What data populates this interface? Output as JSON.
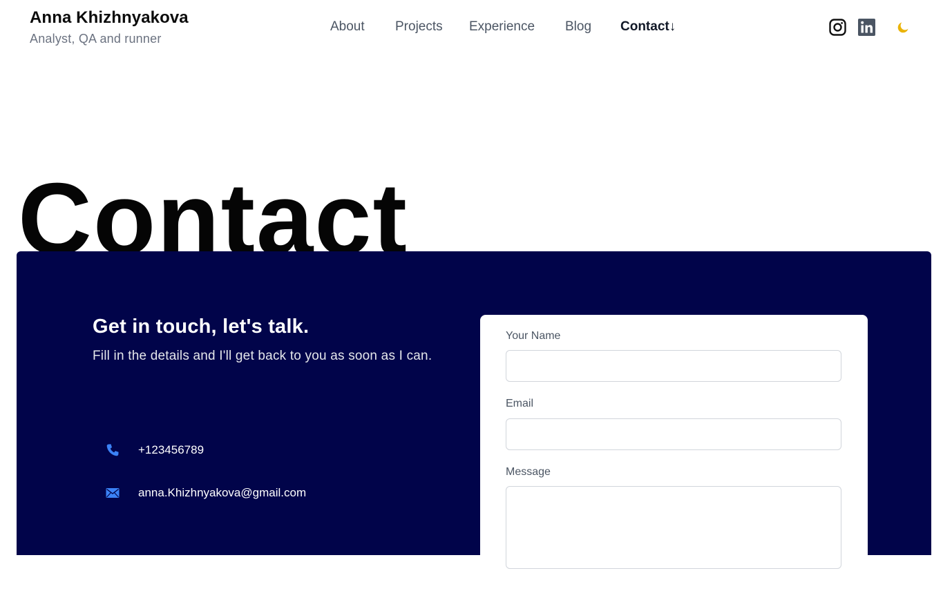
{
  "header": {
    "name": "Anna Khizhnyakova",
    "tagline": "Analyst, QA and runner",
    "nav": [
      {
        "label": "About",
        "active": false
      },
      {
        "label": "Projects",
        "active": false
      },
      {
        "label": "Experience",
        "active": false
      },
      {
        "label": "Blog",
        "active": false
      },
      {
        "label": "Contact↓",
        "active": true
      }
    ],
    "social_icons": [
      "instagram-icon",
      "linkedin-icon"
    ],
    "theme_toggle_icon": "moon-icon"
  },
  "hero": {
    "title": "Contact"
  },
  "contact_panel": {
    "heading": "Get in touch, let's talk.",
    "subheading": "Fill in the details and I'll get back to you as soon as I can.",
    "phone": "+123456789",
    "email": "anna.Khizhnyakova@gmail.com",
    "colors": {
      "panel_bg": "#01044a",
      "icon_accent": "#3b82f6",
      "moon": "#eab308"
    }
  },
  "form": {
    "name_label": "Your Name",
    "name_value": "",
    "email_label": "Email",
    "email_value": "",
    "message_label": "Message",
    "message_value": ""
  }
}
